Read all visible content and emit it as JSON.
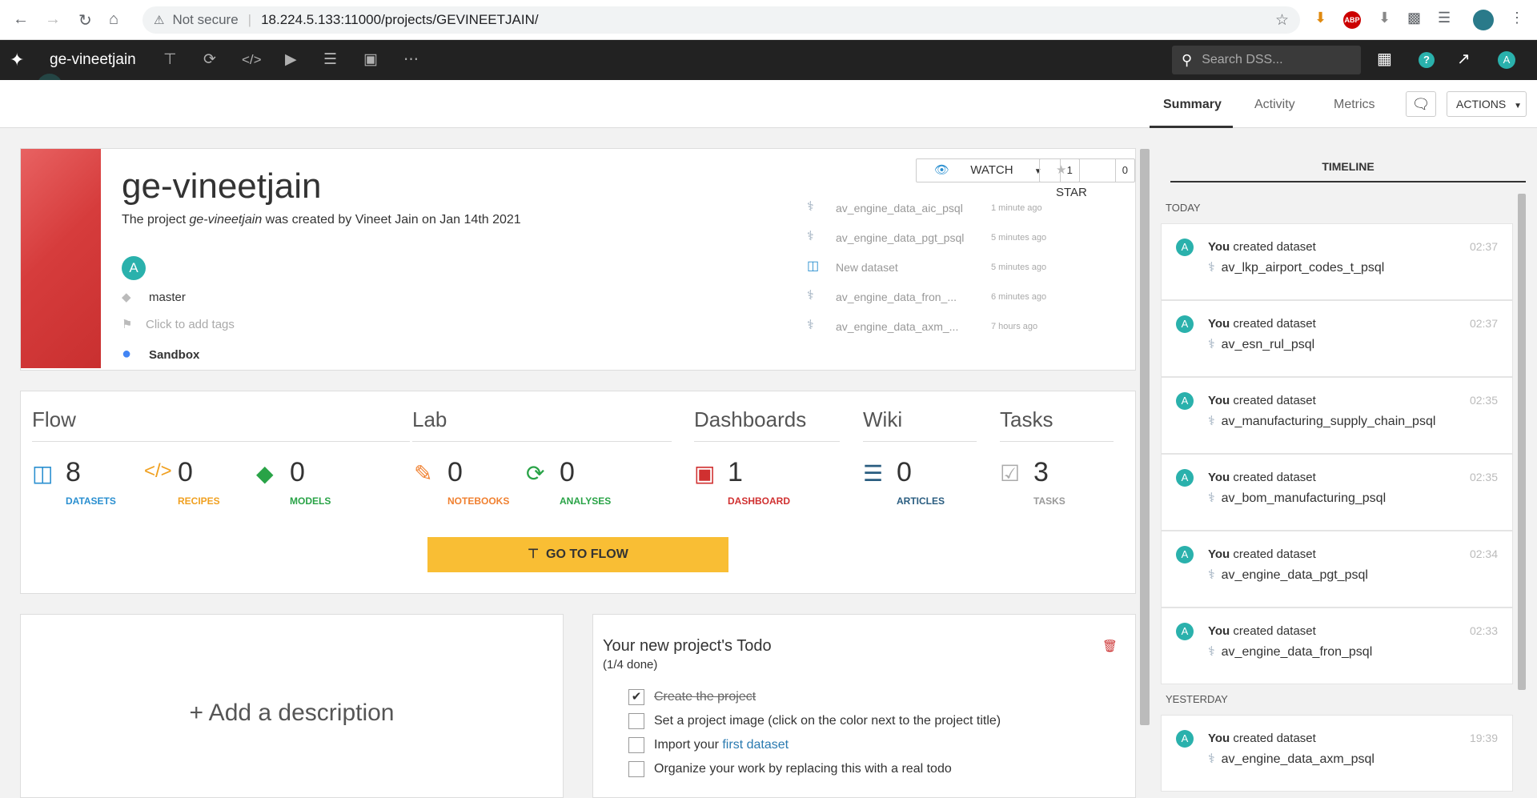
{
  "browser": {
    "security_label": "Not secure",
    "url": "18.224.5.133:11000/projects/GEVINEETJAIN/"
  },
  "topbar": {
    "project_name": "ge-vineetjain",
    "search_placeholder": "Search DSS...",
    "help_label": "?",
    "avatar_letter": "A"
  },
  "subnav": {
    "tabs": [
      {
        "label": "Summary",
        "active": true
      },
      {
        "label": "Activity",
        "active": false
      },
      {
        "label": "Metrics",
        "active": false
      }
    ],
    "actions_label": "ACTIONS"
  },
  "project": {
    "title": "ge-vineetjain",
    "desc_prefix": "The project ",
    "desc_name": "ge-vineetjain",
    "desc_suffix": " was created by Vineet Jain on Jan 14th 2021",
    "owner_letter": "A",
    "branch": "master",
    "tags_placeholder": "Click to add tags",
    "status": "Sandbox",
    "watch_label": "WATCH",
    "watch_count": "1",
    "star_label": "STAR",
    "star_count": "0",
    "recent": [
      {
        "name": "av_engine_data_aic_psql",
        "time": "1 minute ago",
        "icon": "postgres-icon"
      },
      {
        "name": "av_engine_data_pgt_psql",
        "time": "5 minutes ago",
        "icon": "postgres-icon"
      },
      {
        "name": "New dataset",
        "time": "5 minutes ago",
        "icon": "dataset-icon"
      },
      {
        "name": "av_engine_data_fron_...",
        "time": "6 minutes ago",
        "icon": "postgres-icon"
      },
      {
        "name": "av_engine_data_axm_...",
        "time": "7 hours ago",
        "icon": "postgres-icon"
      }
    ]
  },
  "sections": {
    "flow": "Flow",
    "lab": "Lab",
    "dashboards": "Dashboards",
    "wiki": "Wiki",
    "tasks": "Tasks"
  },
  "stats": [
    {
      "num": "8",
      "label": "DATASETS",
      "color": "#2a8fd0"
    },
    {
      "num": "0",
      "label": "RECIPES",
      "color": "#f0a020"
    },
    {
      "num": "0",
      "label": "MODELS",
      "color": "#29a347"
    },
    {
      "num": "0",
      "label": "NOTEBOOKS",
      "color": "#f08030"
    },
    {
      "num": "0",
      "label": "ANALYSES",
      "color": "#29a347"
    },
    {
      "num": "1",
      "label": "DASHBOARD",
      "color": "#d03030"
    },
    {
      "num": "0",
      "label": "ARTICLES",
      "color": "#2a5d80"
    },
    {
      "num": "3",
      "label": "TASKS",
      "color": "#999999"
    }
  ],
  "go_to_flow_label": "GO TO FLOW",
  "description_placeholder": "+ Add a description",
  "todo": {
    "title": "Your new project's Todo",
    "progress": "(1/4 done)",
    "items": [
      {
        "text": "Create the project",
        "done": true
      },
      {
        "text": "Set a project image (click on the color next to the project title)",
        "done": false
      },
      {
        "prefix": "Import your ",
        "link": "first dataset",
        "done": false
      },
      {
        "text": "Organize your work by replacing this with a real todo",
        "done": false
      }
    ]
  },
  "timeline": {
    "title": "TIMELINE",
    "today_label": "TODAY",
    "yesterday_label": "YESTERDAY",
    "actor": "You",
    "verb": "created dataset",
    "entries": [
      {
        "time": "02:37",
        "dataset": "av_lkp_airport_codes_t_psql"
      },
      {
        "time": "02:37",
        "dataset": "av_esn_rul_psql"
      },
      {
        "time": "02:35",
        "dataset": "av_manufacturing_supply_chain_psql"
      },
      {
        "time": "02:35",
        "dataset": "av_bom_manufacturing_psql"
      },
      {
        "time": "02:34",
        "dataset": "av_engine_data_pgt_psql"
      },
      {
        "time": "02:33",
        "dataset": "av_engine_data_fron_psql"
      },
      {
        "time": "19:39",
        "dataset": "av_engine_data_axm_psql"
      }
    ]
  }
}
